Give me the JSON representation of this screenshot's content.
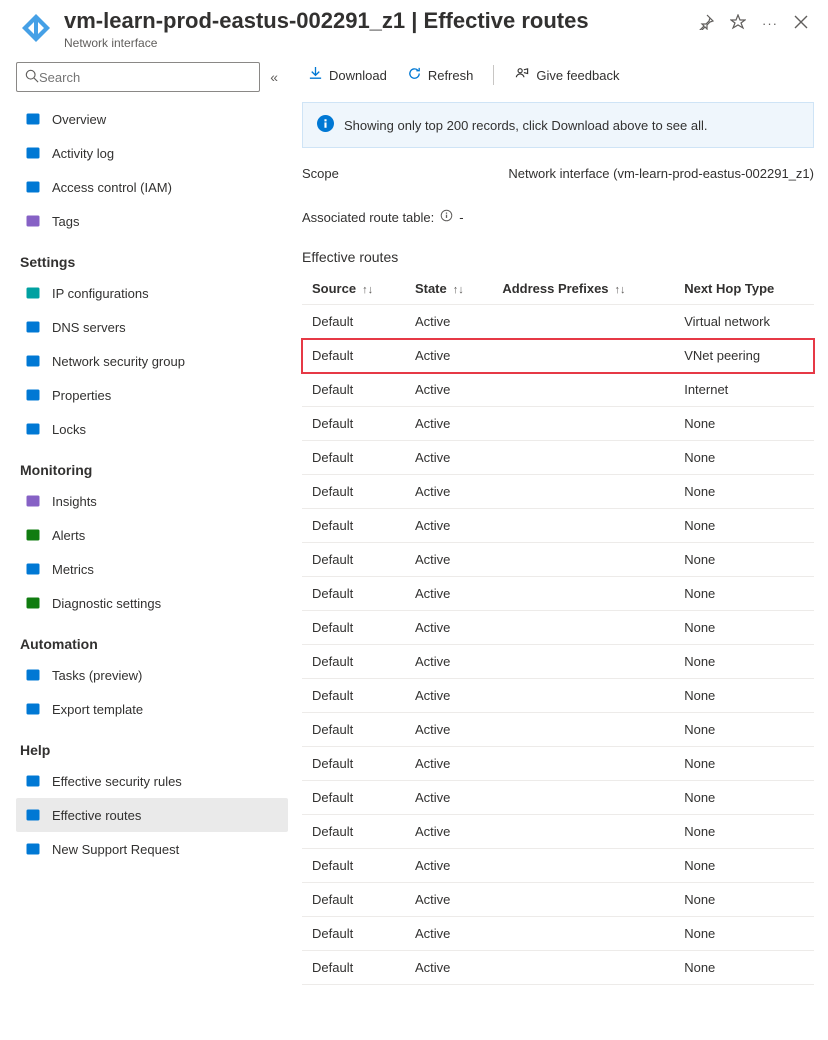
{
  "header": {
    "title": "vm-learn-prod-eastus-002291_z1 | Effective routes",
    "subtitle": "Network interface"
  },
  "search": {
    "placeholder": "Search"
  },
  "sidebar": {
    "top": [
      {
        "label": "Overview",
        "name": "overview"
      },
      {
        "label": "Activity log",
        "name": "activity-log"
      },
      {
        "label": "Access control (IAM)",
        "name": "access-control"
      },
      {
        "label": "Tags",
        "name": "tags"
      }
    ],
    "sections": [
      {
        "title": "Settings",
        "items": [
          {
            "label": "IP configurations",
            "name": "ip-config"
          },
          {
            "label": "DNS servers",
            "name": "dns-servers"
          },
          {
            "label": "Network security group",
            "name": "nsg"
          },
          {
            "label": "Properties",
            "name": "properties"
          },
          {
            "label": "Locks",
            "name": "locks"
          }
        ]
      },
      {
        "title": "Monitoring",
        "items": [
          {
            "label": "Insights",
            "name": "insights"
          },
          {
            "label": "Alerts",
            "name": "alerts"
          },
          {
            "label": "Metrics",
            "name": "metrics"
          },
          {
            "label": "Diagnostic settings",
            "name": "diagnostic"
          }
        ]
      },
      {
        "title": "Automation",
        "items": [
          {
            "label": "Tasks (preview)",
            "name": "tasks"
          },
          {
            "label": "Export template",
            "name": "export-template"
          }
        ]
      },
      {
        "title": "Help",
        "items": [
          {
            "label": "Effective security rules",
            "name": "eff-sec-rules"
          },
          {
            "label": "Effective routes",
            "name": "eff-routes",
            "active": true
          },
          {
            "label": "New Support Request",
            "name": "new-support"
          }
        ]
      }
    ]
  },
  "toolbar": {
    "download": "Download",
    "refresh": "Refresh",
    "feedback": "Give feedback"
  },
  "info": {
    "text": "Showing only top 200 records, click Download above to see all."
  },
  "scope": {
    "label": "Scope",
    "value": "Network interface (vm-learn-prod-eastus-002291_z1)"
  },
  "assoc": {
    "label": "Associated route table:",
    "value": "-"
  },
  "routes": {
    "title": "Effective routes",
    "columns": {
      "source": "Source",
      "state": "State",
      "prefixes": "Address Prefixes",
      "nexthop": "Next Hop Type"
    },
    "rows": [
      {
        "source": "Default",
        "state": "Active",
        "prefixes": "",
        "nexthop": "Virtual network"
      },
      {
        "source": "Default",
        "state": "Active",
        "prefixes": "",
        "nexthop": "VNet peering",
        "highlight": true
      },
      {
        "source": "Default",
        "state": "Active",
        "prefixes": "",
        "nexthop": "Internet"
      },
      {
        "source": "Default",
        "state": "Active",
        "prefixes": "",
        "nexthop": "None"
      },
      {
        "source": "Default",
        "state": "Active",
        "prefixes": "",
        "nexthop": "None"
      },
      {
        "source": "Default",
        "state": "Active",
        "prefixes": "",
        "nexthop": "None"
      },
      {
        "source": "Default",
        "state": "Active",
        "prefixes": "",
        "nexthop": "None"
      },
      {
        "source": "Default",
        "state": "Active",
        "prefixes": "",
        "nexthop": "None"
      },
      {
        "source": "Default",
        "state": "Active",
        "prefixes": "",
        "nexthop": "None"
      },
      {
        "source": "Default",
        "state": "Active",
        "prefixes": "",
        "nexthop": "None"
      },
      {
        "source": "Default",
        "state": "Active",
        "prefixes": "",
        "nexthop": "None"
      },
      {
        "source": "Default",
        "state": "Active",
        "prefixes": "",
        "nexthop": "None"
      },
      {
        "source": "Default",
        "state": "Active",
        "prefixes": "",
        "nexthop": "None"
      },
      {
        "source": "Default",
        "state": "Active",
        "prefixes": "",
        "nexthop": "None"
      },
      {
        "source": "Default",
        "state": "Active",
        "prefixes": "",
        "nexthop": "None"
      },
      {
        "source": "Default",
        "state": "Active",
        "prefixes": "",
        "nexthop": "None"
      },
      {
        "source": "Default",
        "state": "Active",
        "prefixes": "",
        "nexthop": "None"
      },
      {
        "source": "Default",
        "state": "Active",
        "prefixes": "",
        "nexthop": "None"
      },
      {
        "source": "Default",
        "state": "Active",
        "prefixes": "",
        "nexthop": "None"
      },
      {
        "source": "Default",
        "state": "Active",
        "prefixes": "",
        "nexthop": "None"
      }
    ]
  },
  "icon_colors": {
    "overview": "#0078d4",
    "activity-log": "#0078d4",
    "access-control": "#0078d4",
    "tags": "#8661c5",
    "ip-config": "#00a1a1",
    "dns-servers": "#0078d4",
    "nsg": "#0078d4",
    "properties": "#0078d4",
    "locks": "#0078d4",
    "insights": "#8661c5",
    "alerts": "#107c10",
    "metrics": "#0078d4",
    "diagnostic": "#107c10",
    "tasks": "#0078d4",
    "export-template": "#0078d4",
    "eff-sec-rules": "#0078d4",
    "eff-routes": "#0078d4",
    "new-support": "#0078d4"
  }
}
